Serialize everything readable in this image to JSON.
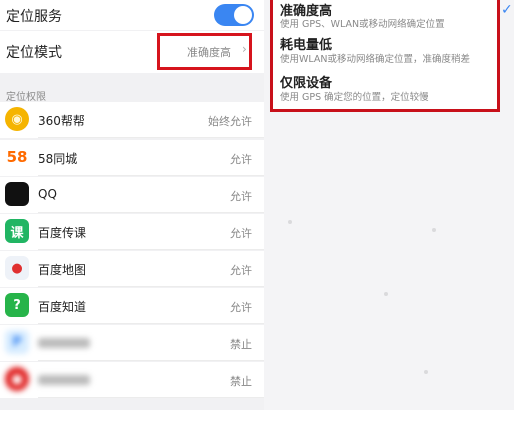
{
  "settings": {
    "location_service_label": "定位服务",
    "location_mode_label": "定位模式",
    "location_mode_value": "准确度高",
    "permissions_section": "定位权限"
  },
  "apps": [
    {
      "name": "360帮帮",
      "status": "始终允许",
      "icon": "360-bangbang-icon",
      "icon_text": "◉",
      "color": "#f5b400"
    },
    {
      "name": "58同城",
      "status": "允许",
      "icon": "58-tongcheng-icon",
      "icon_text": "58",
      "color": "#ffffff"
    },
    {
      "name": "QQ",
      "status": "允许",
      "icon": "qq-penguin-icon",
      "icon_text": "",
      "color": "#111111"
    },
    {
      "name": "百度传课",
      "status": "允许",
      "icon": "baidu-chuanke-icon",
      "icon_text": "课",
      "color": "#21b563"
    },
    {
      "name": "百度地图",
      "status": "允许",
      "icon": "baidu-map-icon",
      "icon_text": "●",
      "color": "#eef2f8"
    },
    {
      "name": "百度知道",
      "status": "允许",
      "icon": "baidu-zhidao-icon",
      "icon_text": "?",
      "color": "#27b44a"
    },
    {
      "name": "",
      "status": "禁止",
      "icon": "video-app-icon",
      "icon_text": "P",
      "color": "#d7ecff"
    },
    {
      "name": "",
      "status": "禁止",
      "icon": "movie-app-icon",
      "icon_text": "●",
      "color": "#e02020"
    }
  ],
  "mode_options": [
    {
      "title": "准确度高",
      "desc": "使用 GPS、WLAN或移动网络确定位置"
    },
    {
      "title": "耗电量低",
      "desc": "使用WLAN或移动网络确定位置，准确度稍差"
    },
    {
      "title": "仅限设备",
      "desc": "使用 GPS 确定您的位置，定位较慢"
    }
  ],
  "colors": {
    "accent": "#3a86f2",
    "highlight": "#d6141d"
  }
}
